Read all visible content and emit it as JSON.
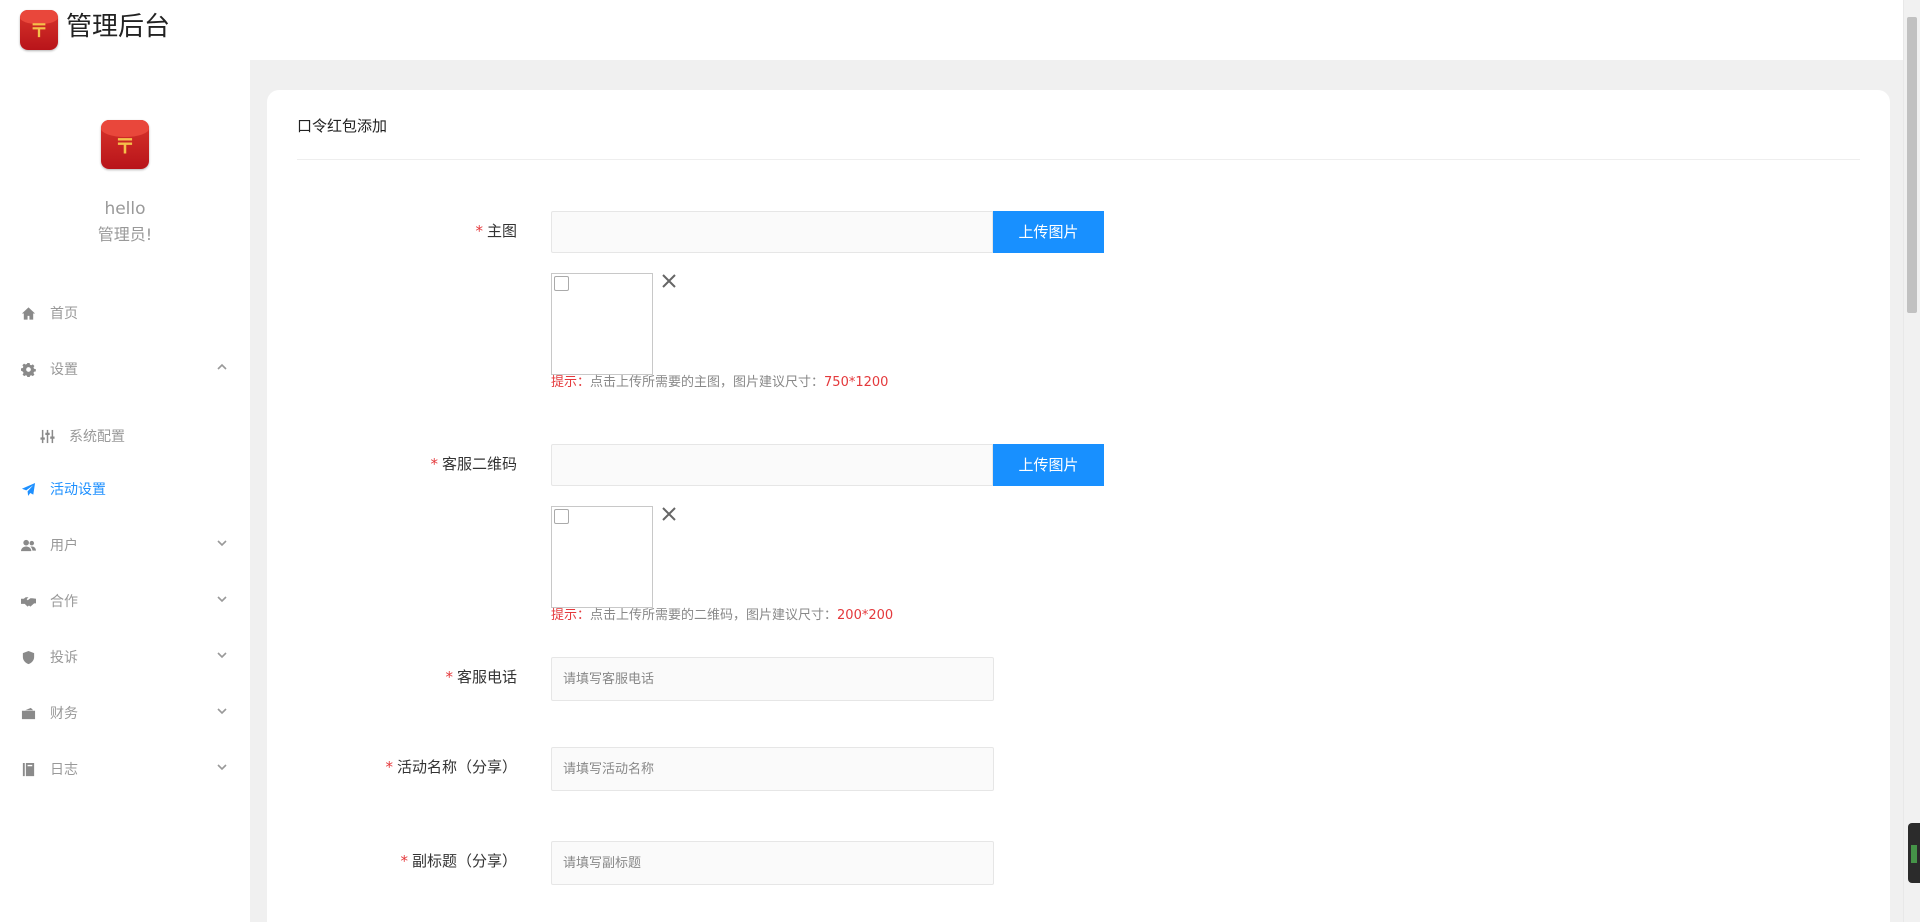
{
  "app": {
    "title": "管理后台",
    "logo_glyph": "〒"
  },
  "profile": {
    "greeting": "hello",
    "role": "管理员!"
  },
  "sidebar": {
    "items": [
      {
        "label": "首页",
        "icon": "home-icon",
        "expandable": false
      },
      {
        "label": "设置",
        "icon": "gear-icon",
        "expandable": true,
        "expanded": true
      },
      {
        "label": "系统配置",
        "icon": "sliders-icon",
        "expandable": false,
        "sub": true
      },
      {
        "label": "活动设置",
        "icon": "paper-plane-icon",
        "expandable": false,
        "active": true
      },
      {
        "label": "用户",
        "icon": "users-icon",
        "expandable": true
      },
      {
        "label": "合作",
        "icon": "handshake-icon",
        "expandable": true
      },
      {
        "label": "投诉",
        "icon": "shield-icon",
        "expandable": true
      },
      {
        "label": "财务",
        "icon": "wallet-icon",
        "expandable": true
      },
      {
        "label": "日志",
        "icon": "book-icon",
        "expandable": true
      }
    ]
  },
  "page": {
    "title": "口令红包添加"
  },
  "form": {
    "required_mark": "*",
    "main_image": {
      "label": "主图",
      "value": "",
      "upload_label": "上传图片",
      "hint_prefix": "提示：",
      "hint_text": "点击上传所需要的主图，图片建议尺寸：",
      "hint_size": "750*1200"
    },
    "qr_code": {
      "label": "客服二维码",
      "value": "",
      "upload_label": "上传图片",
      "hint_prefix": "提示：",
      "hint_text": "点击上传所需要的二维码，图片建议尺寸：",
      "hint_size": "200*200"
    },
    "phone": {
      "label": "客服电话",
      "value": "",
      "placeholder": "请填写客服电话"
    },
    "activity_name": {
      "label": "活动名称（分享）",
      "value": "",
      "placeholder": "请填写活动名称"
    },
    "subtitle": {
      "label": "副标题（分享）",
      "value": "",
      "placeholder": "请填写副标题"
    }
  },
  "colors": {
    "primary": "#1890ff",
    "active_nav": "#1e90ff",
    "required": "#e4393c",
    "brand_red": "#c8201d"
  }
}
